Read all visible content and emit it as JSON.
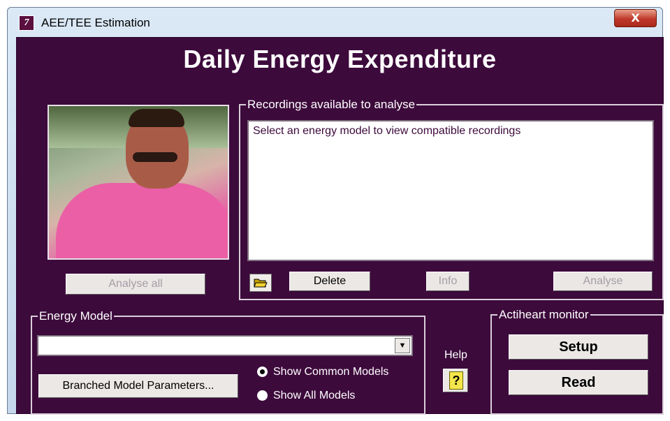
{
  "window": {
    "title": "AEE/TEE Estimation",
    "close_glyph": "X"
  },
  "main": {
    "heading": "Daily Energy Expenditure"
  },
  "photo": {
    "icon": "person-photo"
  },
  "recordings": {
    "group_label": "Recordings available to analyse",
    "list_message": "Select an energy model to view compatible recordings",
    "open_folder_icon": "folder-open-icon",
    "delete_label": "Delete",
    "info_label": "Info",
    "analyse_label": "Analyse"
  },
  "analyse_all_label": "Analyse all",
  "energy_model": {
    "group_label": "Energy Model",
    "selected_value": "",
    "branched_params_label": "Branched Model Parameters...",
    "radio_common": {
      "label": "Show Common Models",
      "checked": true
    },
    "radio_all": {
      "label": "Show All Models",
      "checked": false
    }
  },
  "help": {
    "label": "Help",
    "icon": "question-icon",
    "glyph": "?"
  },
  "actiheart": {
    "group_label": "Actiheart monitor",
    "setup_label": "Setup",
    "read_label": "Read"
  },
  "colors": {
    "background": "#3d0a3c",
    "text": "#ffffff",
    "disabled_text": "#a59da5"
  }
}
